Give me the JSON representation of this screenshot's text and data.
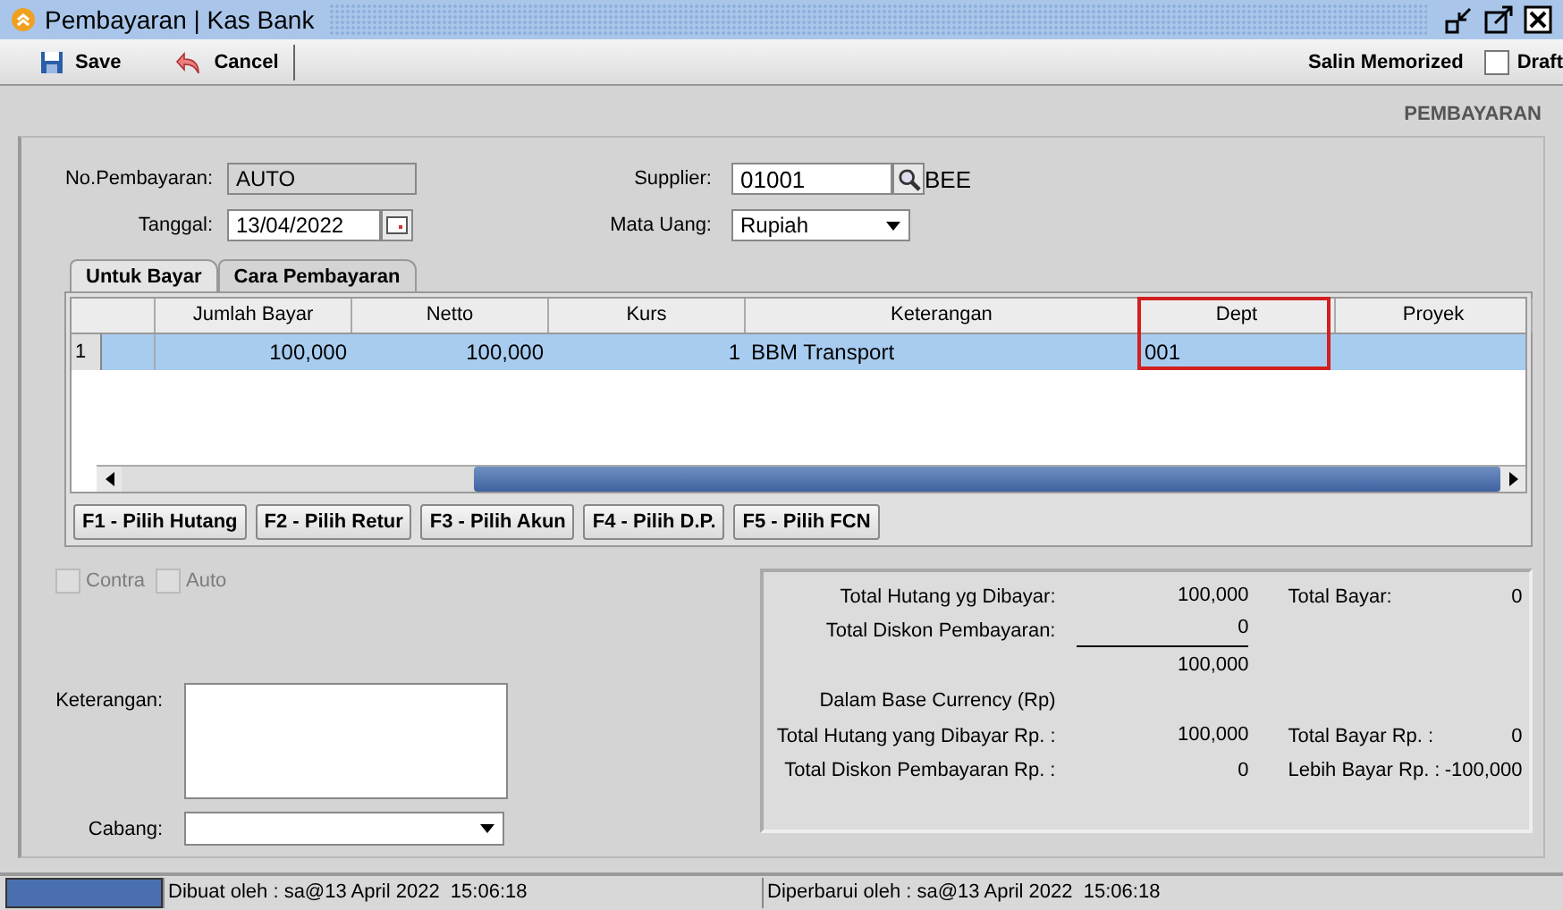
{
  "window": {
    "title": "Pembayaran | Kas Bank"
  },
  "toolbar": {
    "buttons": [
      {
        "label": "Save",
        "kind": "save"
      },
      {
        "label": "Cancel",
        "kind": "cancel"
      }
    ],
    "memorize_label": "Salin Memorized",
    "draft": {
      "label": "Draft",
      "checked": false
    }
  },
  "form_title": "PEMBAYARAN",
  "header_fields": {
    "left": [
      {
        "label": "No.Pembayaran:",
        "value": "AUTO",
        "kind": "readonly"
      },
      {
        "label": "Tanggal:",
        "value": "13/04/2022",
        "kind": "date"
      }
    ],
    "right": [
      {
        "label": "Supplier:",
        "value": "01001",
        "kind": "lookup",
        "extra": "BEE"
      },
      {
        "label": "Mata Uang:",
        "value": "Rupiah",
        "kind": "dropdown"
      }
    ]
  },
  "tabs": [
    {
      "label": "Untuk Bayar",
      "selected": true
    },
    {
      "label": "Cara Pembayaran",
      "selected": false
    }
  ],
  "table": {
    "columns": [
      {
        "label": "Jumlah Bayar",
        "highlighted": false
      },
      {
        "label": "Netto",
        "highlighted": false
      },
      {
        "label": "Kurs",
        "highlighted": false
      },
      {
        "label": "Keterangan",
        "highlighted": false
      },
      {
        "label": "Dept",
        "highlighted": true
      },
      {
        "label": "Proyek",
        "highlighted": false
      }
    ],
    "rows": [
      {
        "number": "1",
        "selected": true,
        "cells": [
          "100,000",
          "100,000",
          "1",
          "BBM Transport",
          "001"
        ]
      }
    ]
  },
  "function_buttons": [
    "F1 - Pilih Hutang",
    "F2 - Pilih Retur",
    "F3 - Pilih Akun",
    "F4 - Pilih D.P.",
    "F5 - Pilih FCN"
  ],
  "options": [
    {
      "label": "Contra",
      "disabled": true
    },
    {
      "label": "Auto",
      "disabled": true
    }
  ],
  "notes_field": {
    "label": "Keterangan:"
  },
  "branch_field": {
    "label": "Cabang:"
  },
  "summary": [
    {
      "label": "Total Hutang yg Dibayar:",
      "value": "100,000",
      "label2": "Total Bayar:",
      "value2": "0",
      "rule": false
    },
    {
      "label": "Total Diskon Pembayaran:",
      "value": "0",
      "rule": true
    },
    {
      "value": "100,000",
      "rule": false
    },
    {
      "label": "Dalam Base Currency (Rp)",
      "rule": false
    },
    {
      "label": "Total Hutang yang Dibayar Rp. :",
      "value": "100,000",
      "label2": "Total Bayar Rp. :",
      "value2": "0",
      "rule": false
    },
    {
      "label": "Total Diskon Pembayaran Rp. :",
      "value": "0",
      "label2": "Lebih Bayar Rp. :",
      "value2": "-100,000",
      "rule": false
    }
  ],
  "status_bar": {
    "created": "Dibuat oleh : sa@13 April 2022  15:06:18",
    "updated": "Diperbarui oleh : sa@13 April 2022  15:06:18"
  }
}
